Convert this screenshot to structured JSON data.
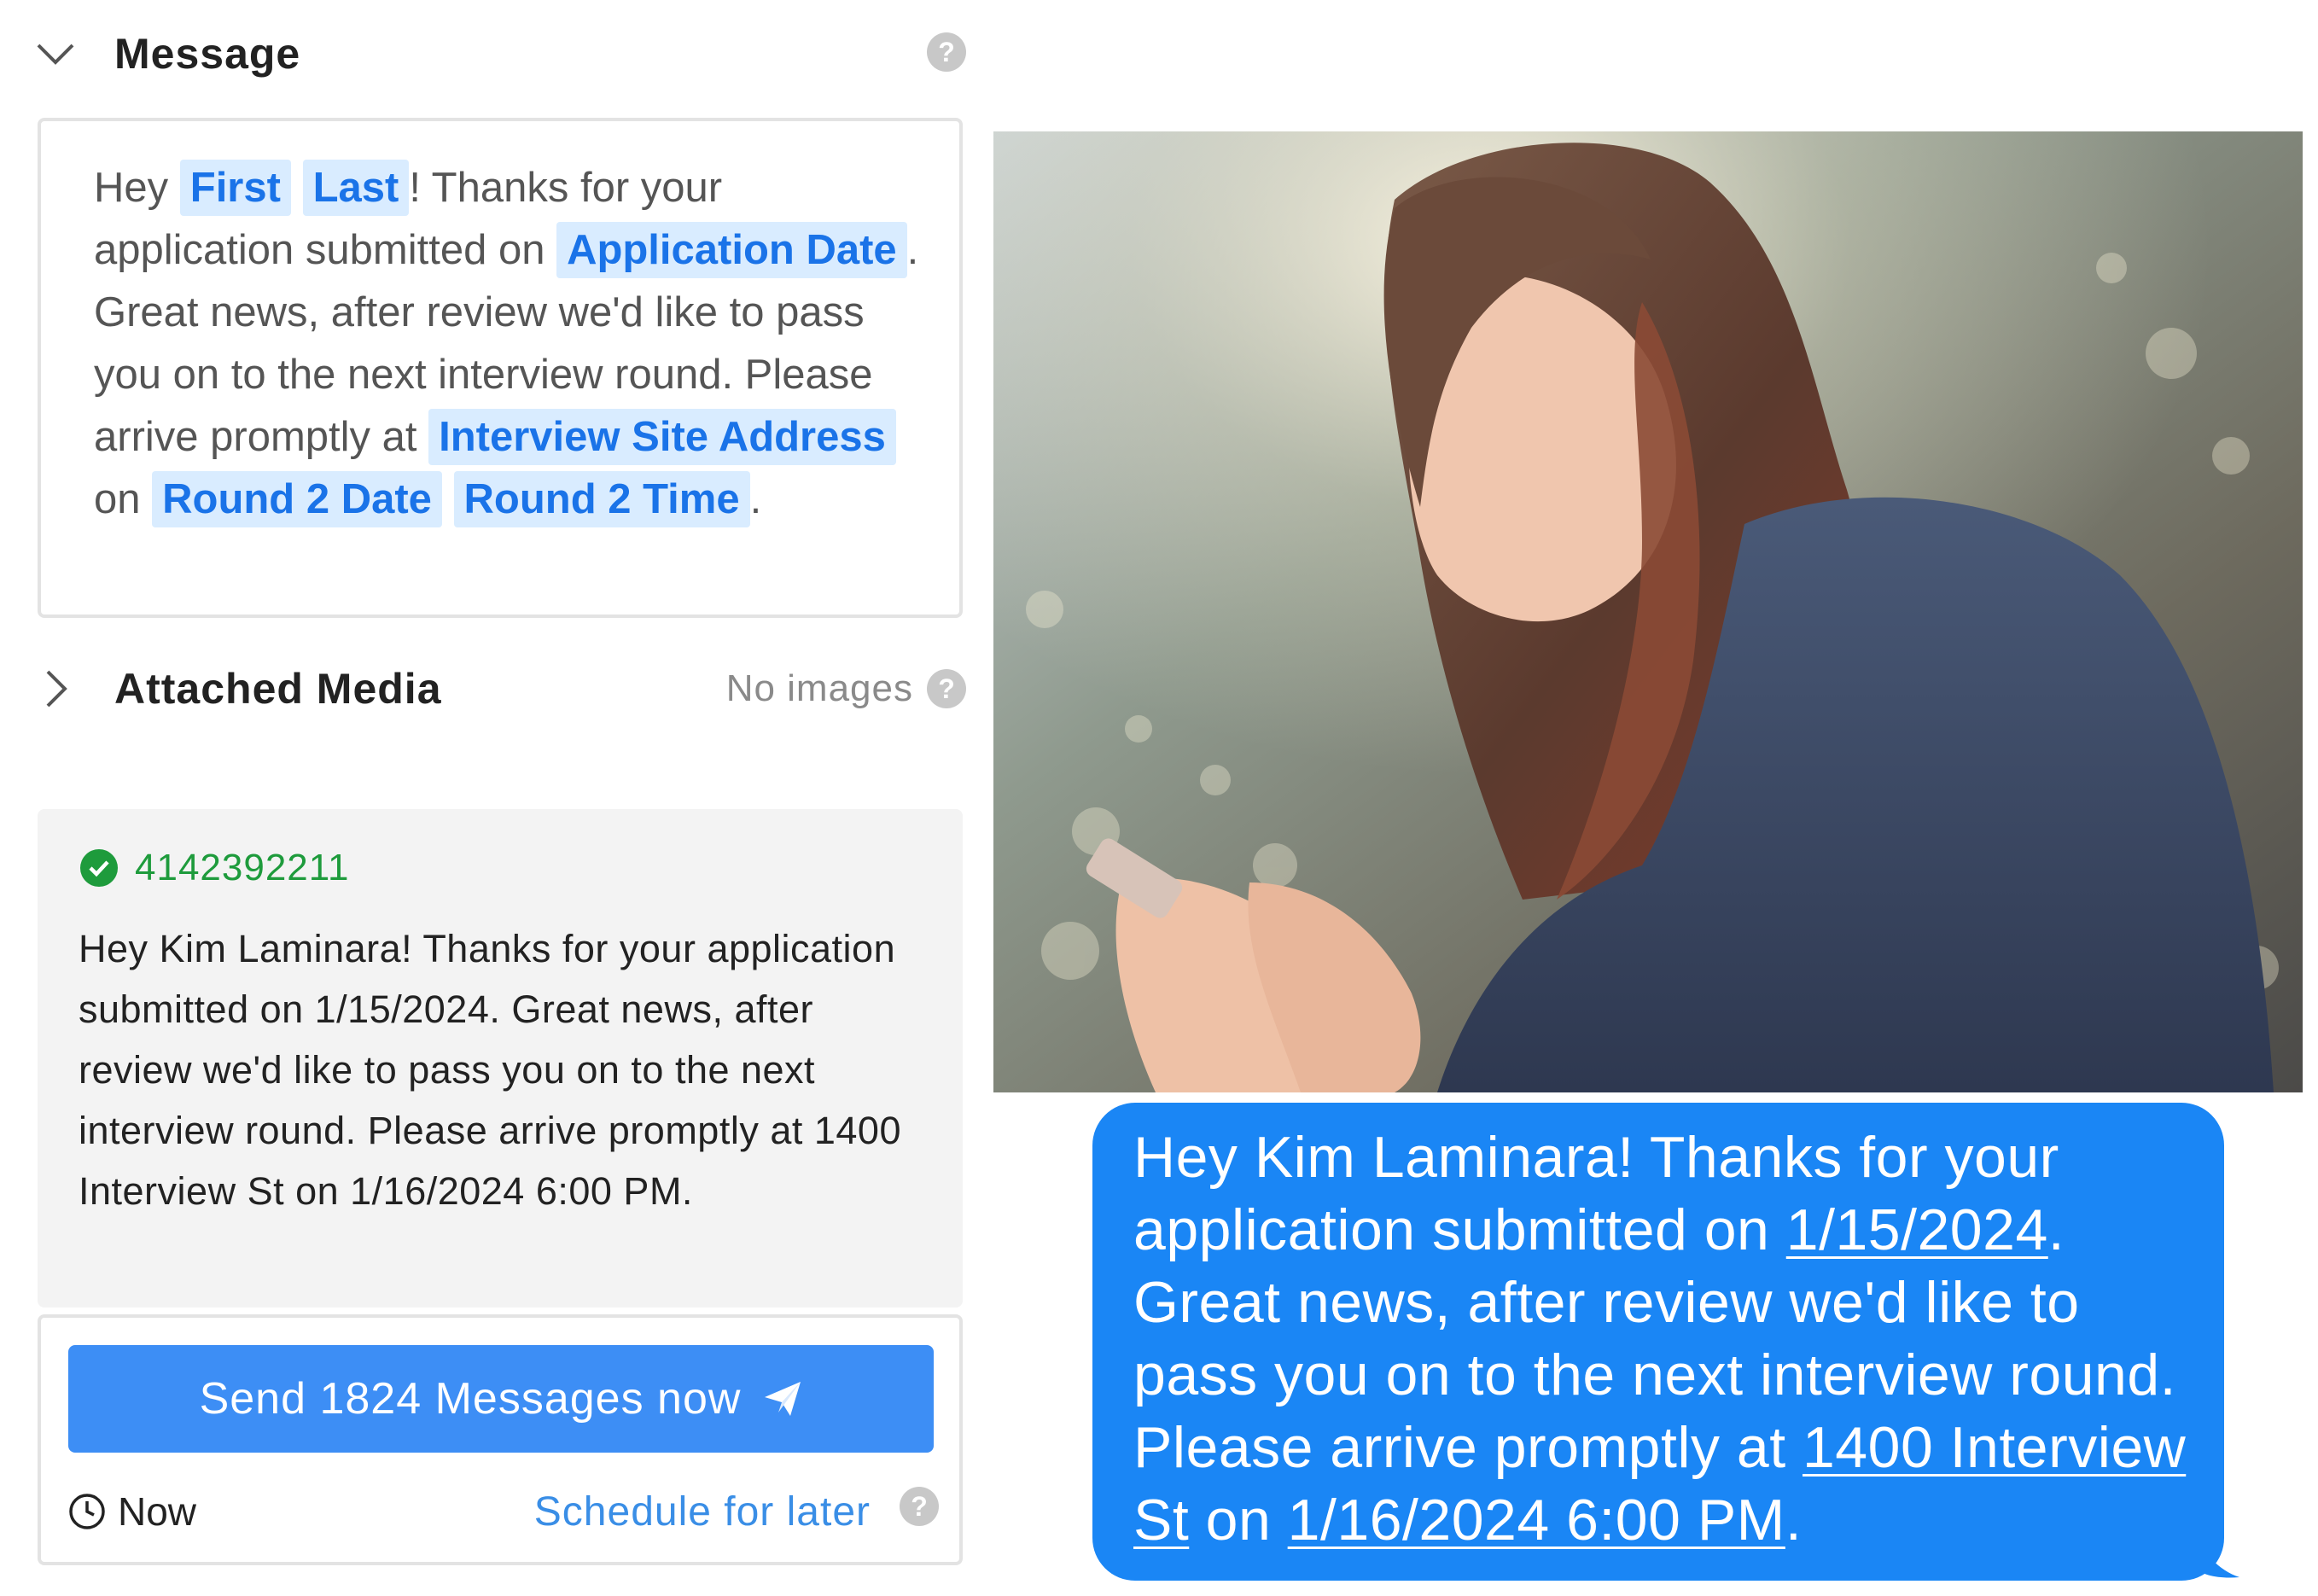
{
  "message_section": {
    "title": "Message",
    "help": "?",
    "template": {
      "t1": "Hey ",
      "first_token": "First",
      "last_token": "Last",
      "t2": "! Thanks for your application submitted on ",
      "app_date_token": "Application Date",
      "t3": ". Great news, after review we'd like to pass you on to the next interview round.  Please arrive promptly at ",
      "site_token": "Interview Site Address",
      "t4": " on ",
      "round2_date_token": "Round 2 Date",
      "round2_time_token": "Round 2 Time",
      "t5": "."
    }
  },
  "attached_media": {
    "title": "Attached Media",
    "status": "No images",
    "help": "?"
  },
  "preview": {
    "phone": "4142392211",
    "text": "Hey Kim Laminara!  Thanks for your application submitted on 1/15/2024. Great news, after review we'd like to pass you on to the next interview round.  Please arrive promptly at 1400 Interview St on 1/16/2024 6:00 PM."
  },
  "send": {
    "button_label": "Send 1824 Messages now",
    "now_label": "Now",
    "schedule_label": "Schedule for later",
    "help": "?"
  },
  "bubble": {
    "p1": "Hey Kim Laminara!  Thanks for your application submitted on ",
    "date1": "1/15/2024",
    "p2": ". Great news, after review we'd like to pass you on to the next interview round.  Please arrive promptly at ",
    "address": "1400 Interview St",
    "p3": " on ",
    "datetime": "1/16/2024 6:00 PM",
    "p4": "."
  },
  "icons": {
    "collapse": "chevron-down-icon",
    "expand": "chevron-right-icon",
    "verified": "check-circle-icon",
    "send": "paper-plane-icon",
    "clock": "clock-icon",
    "help": "question-circle-icon"
  },
  "colors": {
    "accent": "#3d8ef5",
    "token_bg": "#d9ecff",
    "token_text": "#1a73e8",
    "success": "#1e9b3c",
    "bubble": "#1a86f5"
  }
}
